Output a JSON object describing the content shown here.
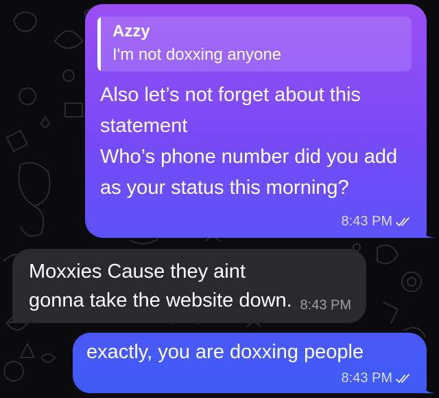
{
  "colors": {
    "background": "#0b0b0d",
    "outgoing_top": "#9a4ff4",
    "outgoing_bottom": "#5c52f7",
    "outgoing_plain": "#3e5cf5",
    "incoming": "#2a2a2e"
  },
  "messages": [
    {
      "direction": "outgoing",
      "reply": {
        "name": "Azzy",
        "text": "I'm not doxxing anyone"
      },
      "text": "Also let’s not forget about this statement\nWho’s phone number did you add as your status this morning?",
      "time": "8:43 PM",
      "status_icon": "double-check-icon"
    },
    {
      "direction": "incoming",
      "text": "Moxxies Cause they aint gonna take the website down.",
      "time": "8:43 PM"
    },
    {
      "direction": "outgoing",
      "text": "exactly, you are doxxing people",
      "time": "8:43 PM",
      "status_icon": "double-check-icon"
    }
  ]
}
